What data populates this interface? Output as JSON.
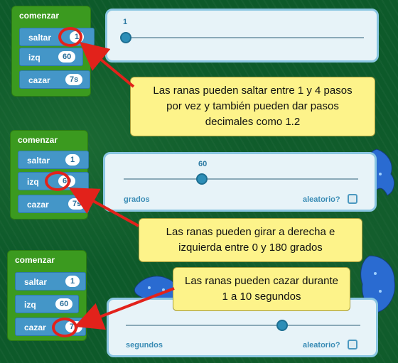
{
  "panels": [
    {
      "block": {
        "title": "comenzar",
        "commands": [
          {
            "label": "saltar",
            "value": "1"
          },
          {
            "label": "izq",
            "value": "60"
          },
          {
            "label": "cazar",
            "value": "7s"
          }
        ]
      },
      "slider": {
        "value_label": "1",
        "level": 0,
        "sub_label": "",
        "random_label": ""
      },
      "callout": "Las ranas pueden saltar entre 1 y 4 pasos por vez y también pueden dar pasos decimales como 1.2"
    },
    {
      "block": {
        "title": "comenzar",
        "commands": [
          {
            "label": "saltar",
            "value": "1"
          },
          {
            "label": "izq",
            "value": "60"
          },
          {
            "label": "cazar",
            "value": "7s"
          }
        ]
      },
      "slider": {
        "value_label": "60",
        "level": 0.333,
        "sub_label": "grados",
        "random_label": "aleatorio?"
      },
      "callout": "Las ranas pueden girar a derecha e izquierda entre 0 y 180 grados"
    },
    {
      "block": {
        "title": "comenzar",
        "commands": [
          {
            "label": "saltar",
            "value": "1"
          },
          {
            "label": "izq",
            "value": "60"
          },
          {
            "label": "cazar",
            "value": "7s"
          }
        ]
      },
      "slider": {
        "value_label": "",
        "level": 0.667,
        "sub_label": "segundos",
        "random_label": "aleatorio?"
      },
      "callout": "Las ranas pueden cazar durante 1 a 10 segundos"
    }
  ],
  "colors": {
    "highlight": "#e2221b",
    "callout_bg": "#fdf38a",
    "block_green": "#3b9a1f",
    "command_blue": "#4496c8"
  }
}
